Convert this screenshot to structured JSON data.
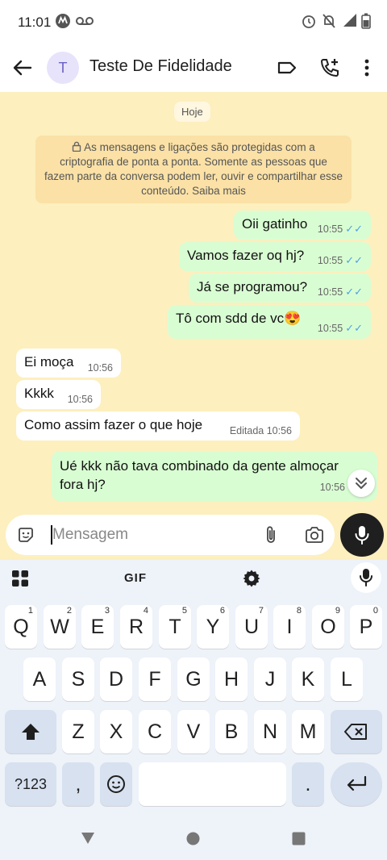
{
  "status_bar": {
    "time": "11:01"
  },
  "header": {
    "avatar_letter": "T",
    "contact_name": "Teste De Fidelidade"
  },
  "chat": {
    "date_chip": "Hoje",
    "encryption_notice": "As mensagens e ligações são protegidas com a criptografia de ponta a ponta. Somente as pessoas que fazem parte da conversa podem ler, ouvir e compartilhar esse conteúdo. Saiba mais",
    "messages": [
      {
        "text": "Oii gatinho",
        "time": "10:55",
        "direction": "out",
        "ticks": "✓✓"
      },
      {
        "text": "Vamos fazer oq hj?",
        "time": "10:55",
        "direction": "out",
        "ticks": "✓✓"
      },
      {
        "text": "Já se programou?",
        "time": "10:55",
        "direction": "out",
        "ticks": "✓✓"
      },
      {
        "text": "Tô com sdd de vc😍",
        "time": "10:55",
        "direction": "out",
        "ticks": "✓✓"
      },
      {
        "text": "Ei moça",
        "time": "10:56",
        "direction": "in"
      },
      {
        "text": "Kkkk",
        "time": "10:56",
        "direction": "in"
      },
      {
        "text": "Como assim fazer o que hoje",
        "time": "Editada 10:56",
        "direction": "in"
      },
      {
        "text": "Ué kkk não tava combinado da gente almoçar fora hj?",
        "time": "10:56",
        "direction": "out"
      }
    ]
  },
  "composer": {
    "placeholder": "Mensagem"
  },
  "keyboard": {
    "gif_label": "GIF",
    "row1": [
      {
        "k": "Q",
        "h": "1"
      },
      {
        "k": "W",
        "h": "2"
      },
      {
        "k": "E",
        "h": "3"
      },
      {
        "k": "R",
        "h": "4"
      },
      {
        "k": "T",
        "h": "5"
      },
      {
        "k": "Y",
        "h": "6"
      },
      {
        "k": "U",
        "h": "7"
      },
      {
        "k": "I",
        "h": "8"
      },
      {
        "k": "O",
        "h": "9"
      },
      {
        "k": "P",
        "h": "0"
      }
    ],
    "row2": [
      "A",
      "S",
      "D",
      "F",
      "G",
      "H",
      "J",
      "K",
      "L"
    ],
    "row3": [
      "Z",
      "X",
      "C",
      "V",
      "B",
      "N",
      "M"
    ],
    "symbols_key": "?123",
    "comma_key": ",",
    "period_key": "."
  },
  "colors": {
    "chat_bg": "#fdefbe",
    "outgoing": "#d9fdd3",
    "incoming": "#ffffff",
    "read_ticks": "#4fa3e0"
  }
}
